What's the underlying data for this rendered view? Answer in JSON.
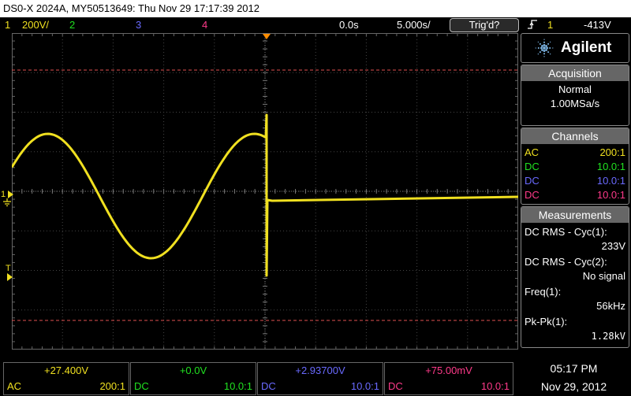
{
  "title_bar": {
    "text": "DS0-X 2024A, MY50513649: Thu Nov 29 17:17:39 2012"
  },
  "status_bar": {
    "ch1_num": "1",
    "ch1_scale": "200V/",
    "ch2_num": "2",
    "ch3_num": "3",
    "ch4_num": "4",
    "time_offset": "0.0s",
    "timebase": "5.000s/",
    "trigger_status": "Trig'd?",
    "trigger_slope_icon": "rising-edge-icon",
    "trigger_channel": "1",
    "trigger_level": "-413V"
  },
  "display": {
    "ch1_marker": "1",
    "trigger_marker": "T",
    "trigger_marker_lower": "T"
  },
  "panel": {
    "brand": "Agilent",
    "acquisition": {
      "header": "Acquisition",
      "mode": "Normal",
      "rate": "1.00MSa/s"
    },
    "channels": {
      "header": "Channels",
      "rows": [
        {
          "coupling": "AC",
          "probe": "200:1"
        },
        {
          "coupling": "DC",
          "probe": "10.0:1"
        },
        {
          "coupling": "DC",
          "probe": "10.0:1"
        },
        {
          "coupling": "DC",
          "probe": "10.0:1"
        }
      ]
    },
    "measurements": {
      "header": "Measurements",
      "items": [
        {
          "label": "DC RMS - Cyc(1):",
          "value": "233V"
        },
        {
          "label": "DC RMS - Cyc(2):",
          "value": "No signal"
        },
        {
          "label": "Freq(1):",
          "value": "56kHz"
        },
        {
          "label": "Pk-Pk(1):",
          "value": "1.28kV"
        }
      ]
    }
  },
  "bottom": {
    "channels": [
      {
        "offset": "+27.400V",
        "coupling": "AC",
        "probe": "200:1"
      },
      {
        "offset": "+0.0V",
        "coupling": "DC",
        "probe": "10.0:1"
      },
      {
        "offset": "+2.93700V",
        "coupling": "DC",
        "probe": "10.0:1"
      },
      {
        "offset": "+75.00mV",
        "coupling": "DC",
        "probe": "10.0:1"
      }
    ],
    "time": "05:17 PM",
    "date": "Nov 29, 2012"
  },
  "colors": {
    "ch1": "#f0e020",
    "ch2": "#20e020",
    "ch3": "#6a6aff",
    "ch4": "#ff3a8a",
    "trigger_marker": "#ff8c00",
    "cursor_line": "#e05050"
  }
}
